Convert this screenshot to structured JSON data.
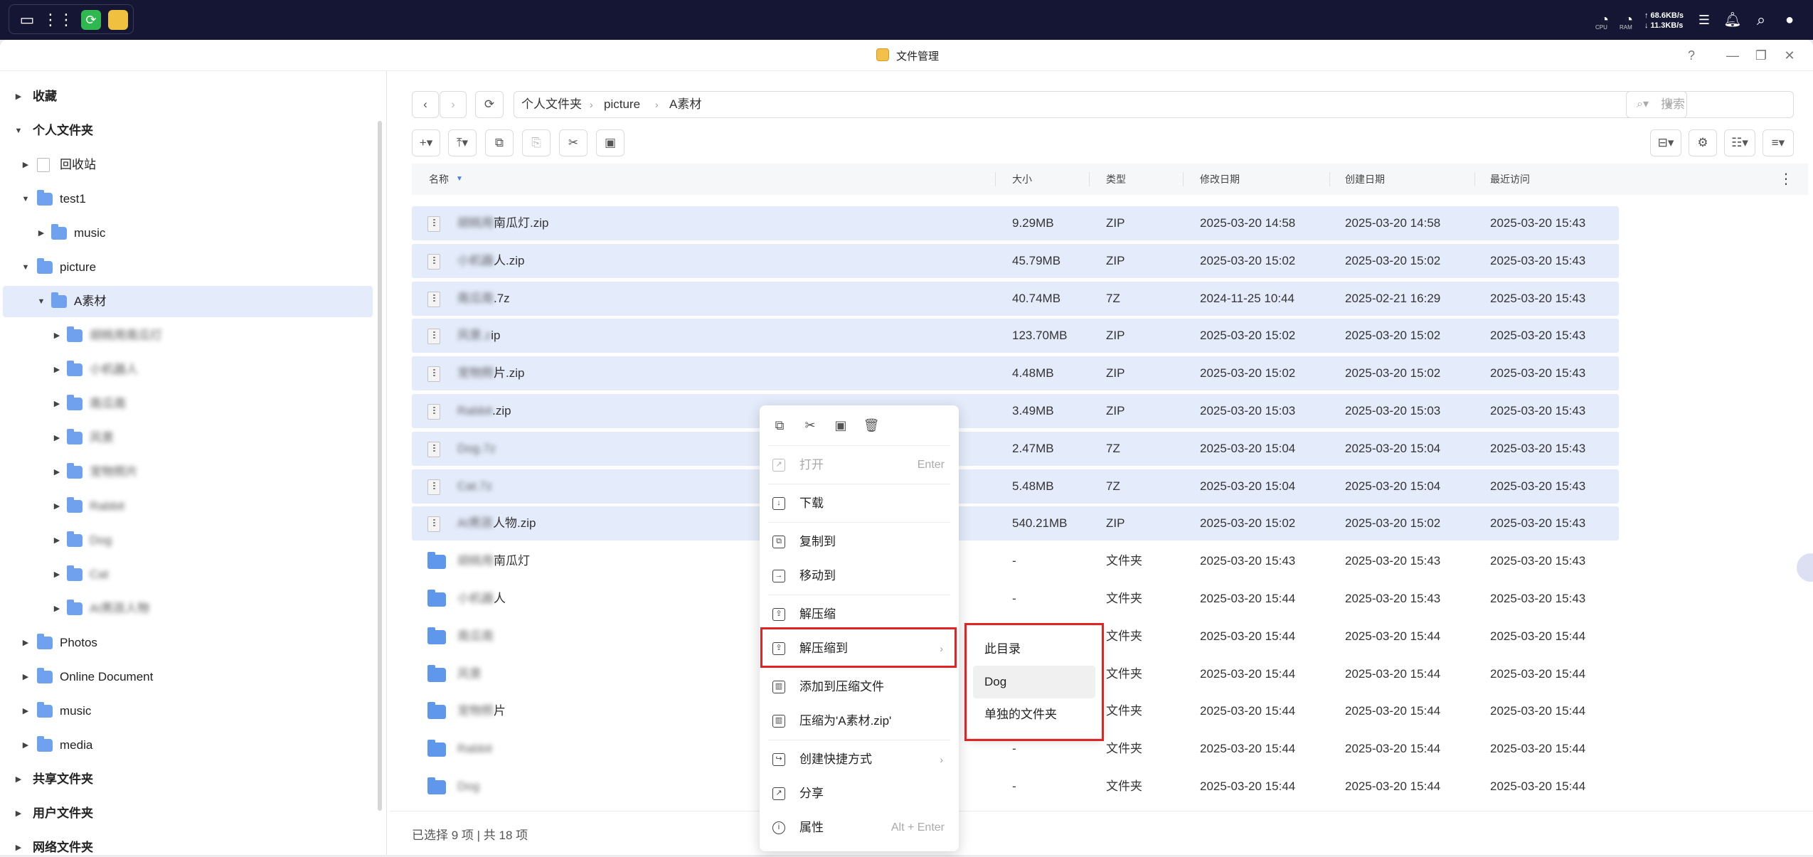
{
  "topbar": {
    "network_up": "↑ 68.6KB/s",
    "network_down": "↓ 11.3KB/s",
    "cpu_label": "CPU",
    "ram_label": "RAM"
  },
  "window": {
    "title": "文件管理",
    "help_icon": "?"
  },
  "sidebar": {
    "items": [
      {
        "label": "收藏",
        "bold": true
      },
      {
        "label": "个人文件夹",
        "bold": true
      },
      {
        "label": "回收站"
      },
      {
        "label": "test1"
      },
      {
        "label": "music"
      },
      {
        "label": "picture"
      },
      {
        "label": "A素材"
      },
      {
        "label": "胡桃用南瓜灯",
        "blurred": true
      },
      {
        "label": "小机器人",
        "blurred": true
      },
      {
        "label": "南瓜南",
        "blurred": true
      },
      {
        "label": "风景",
        "blurred": true
      },
      {
        "label": "宠物照片",
        "blurred": true
      },
      {
        "label": "Rabbit",
        "blurred": true
      },
      {
        "label": "Dog",
        "blurred": true
      },
      {
        "label": "Cat",
        "blurred": true
      },
      {
        "label": "AI男孩人物",
        "blurred": true
      },
      {
        "label": "Photos"
      },
      {
        "label": "Online Document"
      },
      {
        "label": "music"
      },
      {
        "label": "media"
      },
      {
        "label": "共享文件夹",
        "bold": true
      },
      {
        "label": "用户文件夹",
        "bold": true
      },
      {
        "label": "网络文件夹",
        "bold": true
      }
    ]
  },
  "breadcrumb": [
    "个人文件夹",
    "picture",
    "A素材"
  ],
  "search": {
    "placeholder": "搜索"
  },
  "table": {
    "headers": [
      "名称",
      "大小",
      "类型",
      "修改日期",
      "创建日期",
      "最近访问"
    ],
    "rows": [
      {
        "name_hidden": "胡桃用",
        "name_visible": "南瓜灯.zip",
        "size": "9.29MB",
        "type": "ZIP",
        "modified": "2025-03-20 14:58",
        "created": "2025-03-20 14:58",
        "accessed": "2025-03-20 15:43",
        "selected": true,
        "kind": "zip"
      },
      {
        "name_hidden": "小机器",
        "name_visible": "人.zip",
        "size": "45.79MB",
        "type": "ZIP",
        "modified": "2025-03-20 15:02",
        "created": "2025-03-20 15:02",
        "accessed": "2025-03-20 15:43",
        "selected": true,
        "kind": "zip"
      },
      {
        "name_hidden": "南瓜南",
        "name_visible": ".7z",
        "size": "40.74MB",
        "type": "7Z",
        "modified": "2024-11-25 10:44",
        "created": "2025-02-21 16:29",
        "accessed": "2025-03-20 15:43",
        "selected": true,
        "kind": "zip"
      },
      {
        "name_hidden": "风景.z",
        "name_visible": "ip",
        "size": "123.70MB",
        "type": "ZIP",
        "modified": "2025-03-20 15:02",
        "created": "2025-03-20 15:02",
        "accessed": "2025-03-20 15:43",
        "selected": true,
        "kind": "zip"
      },
      {
        "name_hidden": "宠物照",
        "name_visible": "片.zip",
        "size": "4.48MB",
        "type": "ZIP",
        "modified": "2025-03-20 15:02",
        "created": "2025-03-20 15:02",
        "accessed": "2025-03-20 15:43",
        "selected": true,
        "kind": "zip"
      },
      {
        "name_hidden": "Rabbit",
        "name_visible": ".zip",
        "size": "3.49MB",
        "type": "ZIP",
        "modified": "2025-03-20 15:03",
        "created": "2025-03-20 15:03",
        "accessed": "2025-03-20 15:43",
        "selected": true,
        "kind": "zip"
      },
      {
        "name_hidden": "Dog.7z",
        "name_visible": "",
        "size": "2.47MB",
        "type": "7Z",
        "modified": "2025-03-20 15:04",
        "created": "2025-03-20 15:04",
        "accessed": "2025-03-20 15:43",
        "selected": true,
        "kind": "zip"
      },
      {
        "name_hidden": "Cat.7z",
        "name_visible": "",
        "size": "5.48MB",
        "type": "7Z",
        "modified": "2025-03-20 15:04",
        "created": "2025-03-20 15:04",
        "accessed": "2025-03-20 15:43",
        "selected": true,
        "kind": "zip"
      },
      {
        "name_hidden": "AI男孩",
        "name_visible": "人物.zip",
        "size": "540.21MB",
        "type": "ZIP",
        "modified": "2025-03-20 15:02",
        "created": "2025-03-20 15:02",
        "accessed": "2025-03-20 15:43",
        "selected": true,
        "kind": "zip"
      },
      {
        "name_hidden": "胡桃用",
        "name_visible": "南瓜灯",
        "size": "-",
        "type": "文件夹",
        "modified": "2025-03-20 15:43",
        "created": "2025-03-20 15:43",
        "accessed": "2025-03-20 15:43",
        "selected": false,
        "kind": "dir"
      },
      {
        "name_hidden": "小机器",
        "name_visible": "人",
        "size": "-",
        "type": "文件夹",
        "modified": "2025-03-20 15:44",
        "created": "2025-03-20 15:43",
        "accessed": "2025-03-20 15:43",
        "selected": false,
        "kind": "dir"
      },
      {
        "name_hidden": "南瓜南",
        "name_visible": "",
        "size": "-",
        "type": "文件夹",
        "modified": "2025-03-20 15:44",
        "created": "2025-03-20 15:44",
        "accessed": "2025-03-20 15:44",
        "selected": false,
        "kind": "dir"
      },
      {
        "name_hidden": "风景",
        "name_visible": "",
        "size": "-",
        "type": "文件夹",
        "modified": "2025-03-20 15:44",
        "created": "2025-03-20 15:44",
        "accessed": "2025-03-20 15:44",
        "selected": false,
        "kind": "dir"
      },
      {
        "name_hidden": "宠物照",
        "name_visible": "片",
        "size": "-",
        "type": "文件夹",
        "modified": "2025-03-20 15:44",
        "created": "2025-03-20 15:44",
        "accessed": "2025-03-20 15:44",
        "selected": false,
        "kind": "dir"
      },
      {
        "name_hidden": "Rabbit",
        "name_visible": "",
        "size": "-",
        "type": "文件夹",
        "modified": "2025-03-20 15:44",
        "created": "2025-03-20 15:44",
        "accessed": "2025-03-20 15:44",
        "selected": false,
        "kind": "dir"
      },
      {
        "name_hidden": "Dog",
        "name_visible": "",
        "size": "-",
        "type": "文件夹",
        "modified": "2025-03-20 15:44",
        "created": "2025-03-20 15:44",
        "accessed": "2025-03-20 15:44",
        "selected": false,
        "kind": "dir"
      }
    ]
  },
  "status": "已选择 9 项 | 共 18 项",
  "context_menu": {
    "items": [
      {
        "label": "打开",
        "shortcut": "Enter",
        "disabled": true,
        "icon": "open-icon"
      },
      {
        "label": "下载",
        "icon": "download-icon"
      },
      {
        "label": "复制到",
        "icon": "copy-to-icon"
      },
      {
        "label": "移动到",
        "icon": "move-to-icon"
      },
      {
        "label": "解压缩",
        "icon": "extract-icon"
      },
      {
        "label": "解压缩到",
        "submenu": true,
        "icon": "extract-to-icon"
      },
      {
        "label": "添加到压缩文件",
        "icon": "add-archive-icon"
      },
      {
        "label": "压缩为'A素材.zip'",
        "icon": "compress-icon"
      },
      {
        "label": "创建快捷方式",
        "submenu": true,
        "icon": "shortcut-icon"
      },
      {
        "label": "分享",
        "icon": "share-icon"
      },
      {
        "label": "属性",
        "shortcut": "Alt + Enter",
        "icon": "info-icon"
      }
    ]
  },
  "submenu": {
    "items": [
      "此目录",
      "Dog",
      "单独的文件夹"
    ]
  },
  "colors": {
    "topbar_bg": "#141633",
    "selection_bg": "#e4ecfb",
    "folder_blue": "#5e97ec",
    "highlight_red": "#e02424"
  }
}
